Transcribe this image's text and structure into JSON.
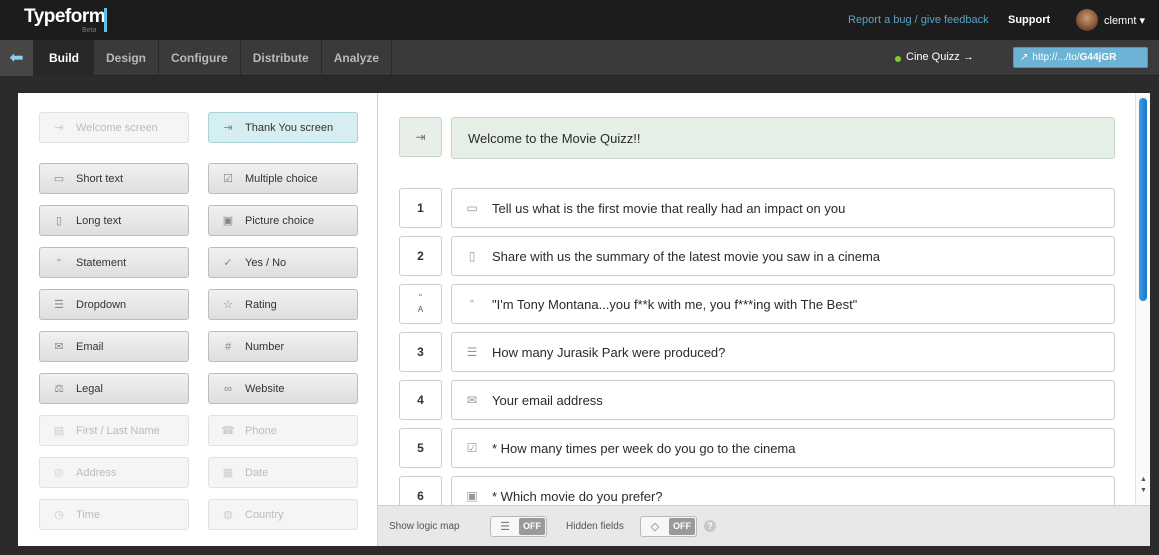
{
  "topbar": {
    "logo": "Typeform",
    "logo_sub": "Beta",
    "feedback_link": "Report a bug / give feedback",
    "support": "Support",
    "user": "clemnt ▾"
  },
  "nav": {
    "tabs": [
      "Build",
      "Design",
      "Configure",
      "Distribute",
      "Analyze"
    ],
    "active_tab": "Build",
    "project": "Cine Quizz →",
    "url_prefix": "http://.../to/",
    "url_code": "G44jGR"
  },
  "question_types": {
    "welcome": "Welcome screen",
    "thank_you": "Thank You screen",
    "short_text": "Short text",
    "multiple_choice": "Multiple choice",
    "long_text": "Long text",
    "picture_choice": "Picture choice",
    "statement": "Statement",
    "yes_no": "Yes / No",
    "dropdown": "Dropdown",
    "rating": "Rating",
    "email": "Email",
    "number": "Number",
    "legal": "Legal",
    "website": "Website",
    "first_last_name": "First / Last Name",
    "phone": "Phone",
    "address": "Address",
    "date": "Date",
    "time": "Time",
    "country": "Country"
  },
  "questions": {
    "welcome": "Welcome to the Movie Quizz!!",
    "items": [
      {
        "num": "1",
        "icon": "short-text",
        "text": "Tell us what is the first movie that really had an impact on you"
      },
      {
        "num": "2",
        "icon": "long-text",
        "text": "Share with us the summary of the latest movie you saw in a cinema"
      },
      {
        "num": "A",
        "icon": "statement",
        "text": "\"I'm Tony Montana...you f**k with me, you f***ing with The Best\""
      },
      {
        "num": "3",
        "icon": "dropdown",
        "text": "How many Jurasik Park were produced?"
      },
      {
        "num": "4",
        "icon": "email",
        "text": "Your email address"
      },
      {
        "num": "5",
        "icon": "multiple-choice",
        "text": "* How many times per week do you go to the cinema"
      },
      {
        "num": "6",
        "icon": "picture-choice",
        "text": "* Which movie do you prefer?"
      }
    ]
  },
  "bottom": {
    "logic_map_label": "Show logic map",
    "logic_map_state": "OFF",
    "hidden_fields_label": "Hidden fields",
    "hidden_fields_state": "OFF",
    "help": "?"
  }
}
